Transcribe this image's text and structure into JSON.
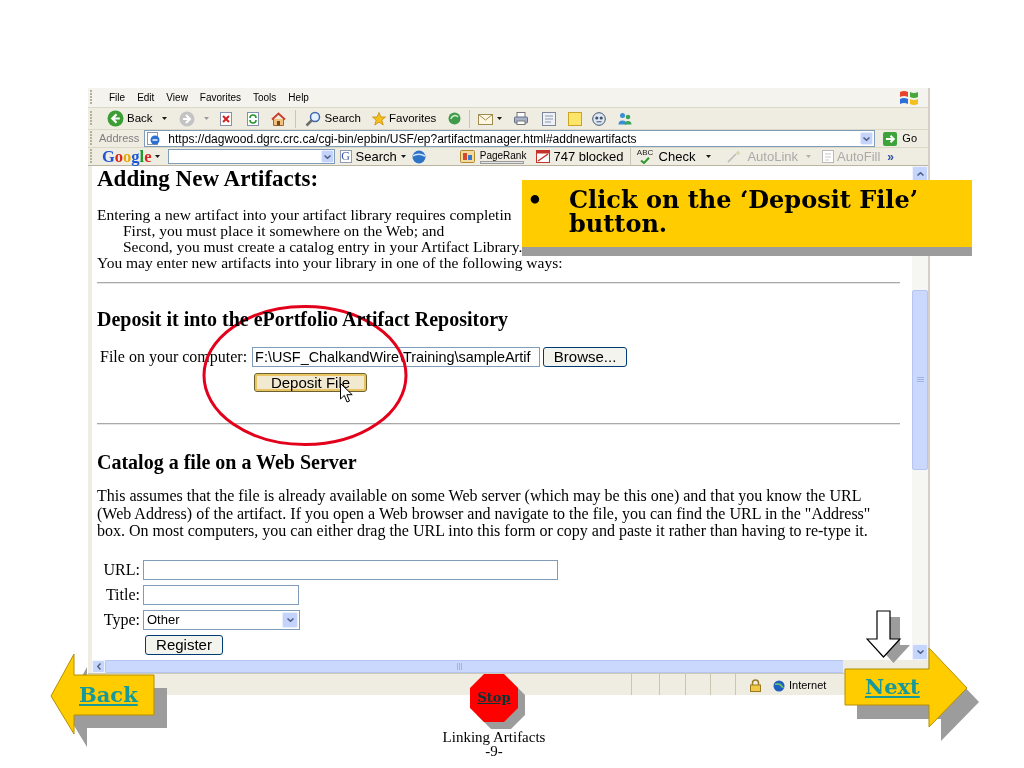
{
  "browser": {
    "menu_bar": [
      "File",
      "Edit",
      "View",
      "Favorites",
      "Tools",
      "Help"
    ],
    "toolbar": {
      "back": "Back",
      "search": "Search",
      "favorites": "Favorites"
    },
    "address_bar": {
      "label": "Address",
      "url": "https://dagwood.dgrc.crc.ca/cgi-bin/epbin/USF/ep?artifactmanager.html#addnewartifacts",
      "go": "Go"
    },
    "google_bar": {
      "logo": "Google",
      "search": {
        "icon": "G",
        "label": "Search"
      },
      "pagerank": "PageRank",
      "blocked": "747 blocked",
      "check": {
        "icon": "ABC",
        "label": "Check"
      },
      "tools": [
        {
          "kind": "dropdown",
          "label": "AutoLink",
          "disabled": true
        },
        {
          "kind": "button",
          "label": "AutoFill",
          "disabled": true
        }
      ],
      "more": "»"
    },
    "page": {
      "heading": "Adding New Artifacts:",
      "intro": "Entering a new artifact into your artifact library requires completin",
      "steps": [
        "First, you must place it somewhere on the Web; and",
        "Second, you must create a catalog entry in your Artifact Library."
      ],
      "outro": "You may enter new artifacts into your library in one of the following ways:",
      "deposit": {
        "title": "Deposit it into the ePortfolio Artifact Repository",
        "file_label": "File on your computer:",
        "file_value": "F:\\USF_ChalkandWire\\Training\\sampleArtif",
        "browse": "Browse...",
        "submit": "Deposit File"
      },
      "catalog": {
        "title": "Catalog a file on a Web Server",
        "description": "This assumes that the file is already available on some Web server (which may be this one) and that you know the URL (Web Address) of the artifact. If you open a Web browser and navigate to the file, you can find the URL in the \"Address\" box. On most computers, you can either drag the URL into this form or copy and paste it rather than having to re-type it.",
        "fields": [
          {
            "kind": "text",
            "label": "URL:"
          },
          {
            "kind": "short_text",
            "label": "Title:"
          },
          {
            "kind": "select",
            "label": "Type:",
            "value": "Other"
          }
        ],
        "submit": "Register"
      }
    },
    "status_bar": {
      "zone": "Internet"
    }
  },
  "callout": {
    "bullet": "•",
    "text": "Click on the ‘Deposit File’ button."
  },
  "navigation": {
    "back": "Back",
    "stop": "Stop",
    "next": "Next"
  },
  "footer": {
    "title": "Linking Artifacts",
    "page": "-9-"
  }
}
